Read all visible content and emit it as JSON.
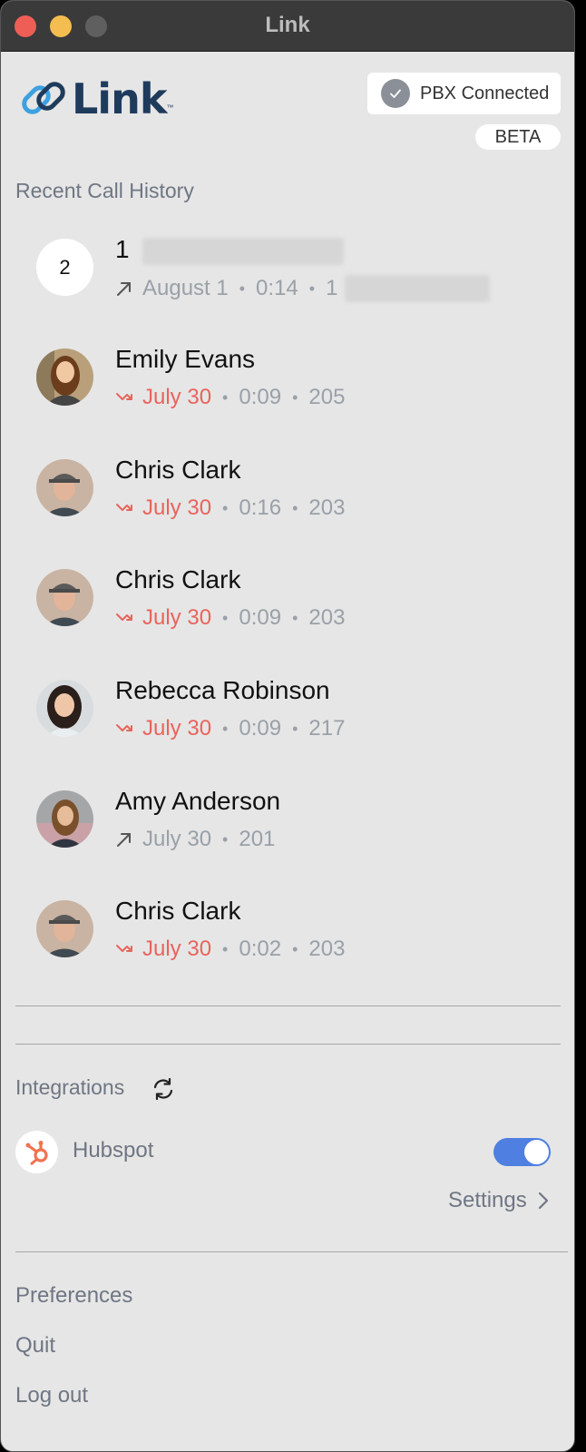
{
  "window": {
    "title": "Link"
  },
  "header": {
    "logo_text": "Link",
    "pbx_status": "PBX Connected",
    "beta_label": "BETA"
  },
  "call_history": {
    "title": "Recent Call History",
    "items": [
      {
        "avatar": "count-badge",
        "count": "2",
        "name": "1",
        "direction": "outgoing",
        "date": "August 1",
        "duration": "0:14",
        "extension": "1",
        "name_redacted": true,
        "extension_redacted": true
      },
      {
        "avatar": "photo-woman-long-hair",
        "name": "Emily Evans",
        "direction": "missed",
        "date": "July 30",
        "duration": "0:09",
        "extension": "205"
      },
      {
        "avatar": "photo-man-cap",
        "name": "Chris Clark",
        "direction": "missed",
        "date": "July 30",
        "duration": "0:16",
        "extension": "203"
      },
      {
        "avatar": "photo-man-cap",
        "name": "Chris Clark",
        "direction": "missed",
        "date": "July 30",
        "duration": "0:09",
        "extension": "203"
      },
      {
        "avatar": "photo-woman-dark-hair",
        "name": "Rebecca Robinson",
        "direction": "missed",
        "date": "July 30",
        "duration": "0:09",
        "extension": "217"
      },
      {
        "avatar": "photo-woman-outdoor",
        "name": "Amy Anderson",
        "direction": "outgoing",
        "date": "July 30",
        "duration": "",
        "extension": "201"
      },
      {
        "avatar": "photo-man-cap",
        "name": "Chris Clark",
        "direction": "missed",
        "date": "July 30",
        "duration": "0:02",
        "extension": "203"
      }
    ]
  },
  "integrations": {
    "title": "Integrations",
    "refresh_icon": "sync-icon",
    "items": [
      {
        "name": "Hubspot",
        "icon": "hubspot-icon",
        "enabled": true,
        "settings_label": "Settings"
      }
    ]
  },
  "menu": {
    "preferences": "Preferences",
    "quit": "Quit",
    "logout": "Log out"
  },
  "colors": {
    "accent": "#4f7fe0",
    "missed": "#e8645c",
    "muted": "#6f7683",
    "logo": "#1f3b5c",
    "hubspot": "#f2714f"
  }
}
